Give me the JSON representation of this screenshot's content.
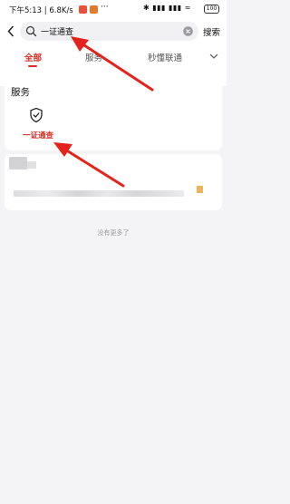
{
  "status_bar": {
    "time": "下午5:13 | 6.8K/s",
    "dots": "···",
    "icons": "✱ ▮▮▮ ▮▮▮ ≈",
    "battery": "100"
  },
  "search": {
    "value": "一证通查",
    "action_label": "搜索"
  },
  "tabs": [
    {
      "label": "全部",
      "active": true
    },
    {
      "label": "服务",
      "active": false
    },
    {
      "label": "秒懂联通",
      "active": false
    }
  ],
  "services": {
    "title": "服务",
    "items": [
      {
        "label": "一证通查",
        "icon": "shield-check-icon"
      }
    ]
  },
  "footer": {
    "no_more": "没有更多了"
  },
  "colors": {
    "accent": "#d72e25",
    "annotation": "#e3231d",
    "background": "#f4f4f6"
  }
}
